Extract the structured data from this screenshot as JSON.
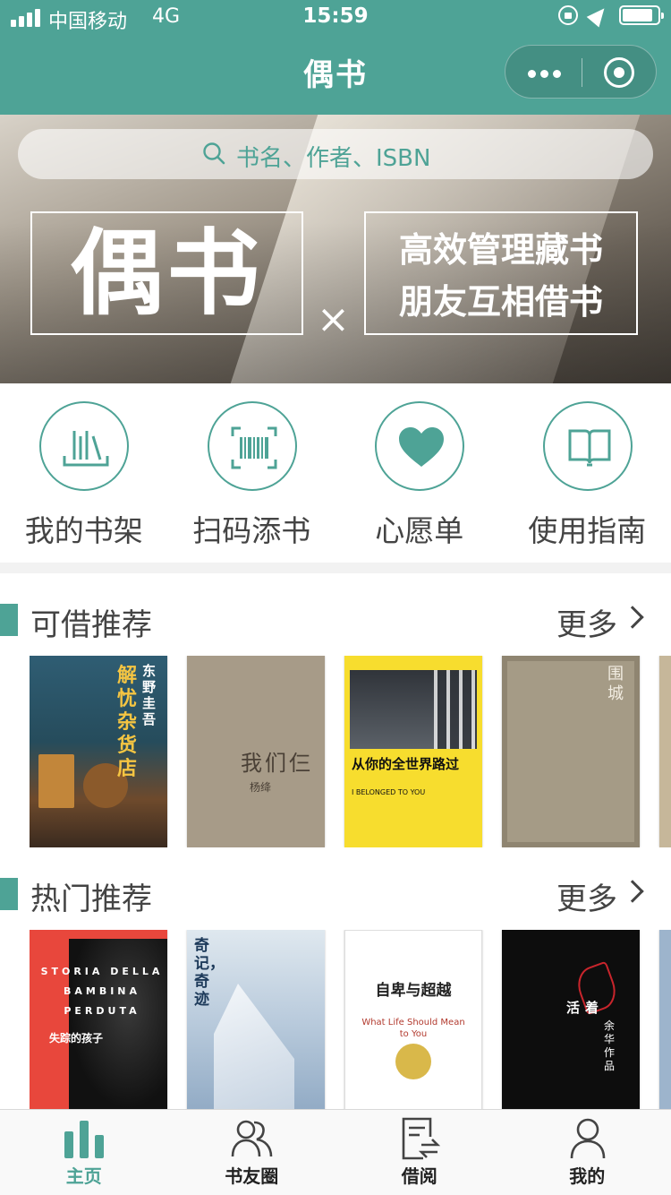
{
  "status_bar": {
    "carrier": "中国移动",
    "network": "4G",
    "time": "15:59"
  },
  "nav": {
    "title": "偶书"
  },
  "search": {
    "placeholder": "书名、作者、ISBN"
  },
  "banner": {
    "logo_text": "偶书",
    "cross": "×",
    "slogan_line1": "高效管理藏书",
    "slogan_line2": "朋友互相借书"
  },
  "shortcuts": [
    {
      "label": "我的书架",
      "icon": "bookshelf-icon"
    },
    {
      "label": "扫码添书",
      "icon": "barcode-scan-icon"
    },
    {
      "label": "心愿单",
      "icon": "heart-icon"
    },
    {
      "label": "使用指南",
      "icon": "open-book-icon"
    }
  ],
  "sections": [
    {
      "title": "可借推荐",
      "more": "更多",
      "books": [
        {
          "title": "解忧杂货店",
          "author": "东野圭吾"
        },
        {
          "title": "我们仨",
          "author": "杨绛"
        },
        {
          "title": "从你的全世界路过",
          "subtitle": "I BELONGED TO YOU"
        },
        {
          "title": "围城"
        }
      ]
    },
    {
      "title": "热门推荐",
      "more": "更多",
      "books": [
        {
          "title": "STORIA DELLA BAMBINA PERDUTA",
          "subtitle": "失踪的孩子"
        },
        {
          "title": "奇记，奇迹"
        },
        {
          "title": "自卑与超越",
          "subtitle": "What Life Should Mean to You"
        },
        {
          "title": "活着",
          "author": "余华作品"
        }
      ]
    }
  ],
  "tabbar": [
    {
      "label": "主页",
      "icon": "home-bars-icon",
      "active": true
    },
    {
      "label": "书友圈",
      "icon": "friends-icon",
      "active": false
    },
    {
      "label": "借阅",
      "icon": "borrow-icon",
      "active": false
    },
    {
      "label": "我的",
      "icon": "profile-icon",
      "active": false
    }
  ],
  "colors": {
    "accent": "#4ea396",
    "tab_active": "#4ea396",
    "tab_inactive": "#222222"
  }
}
